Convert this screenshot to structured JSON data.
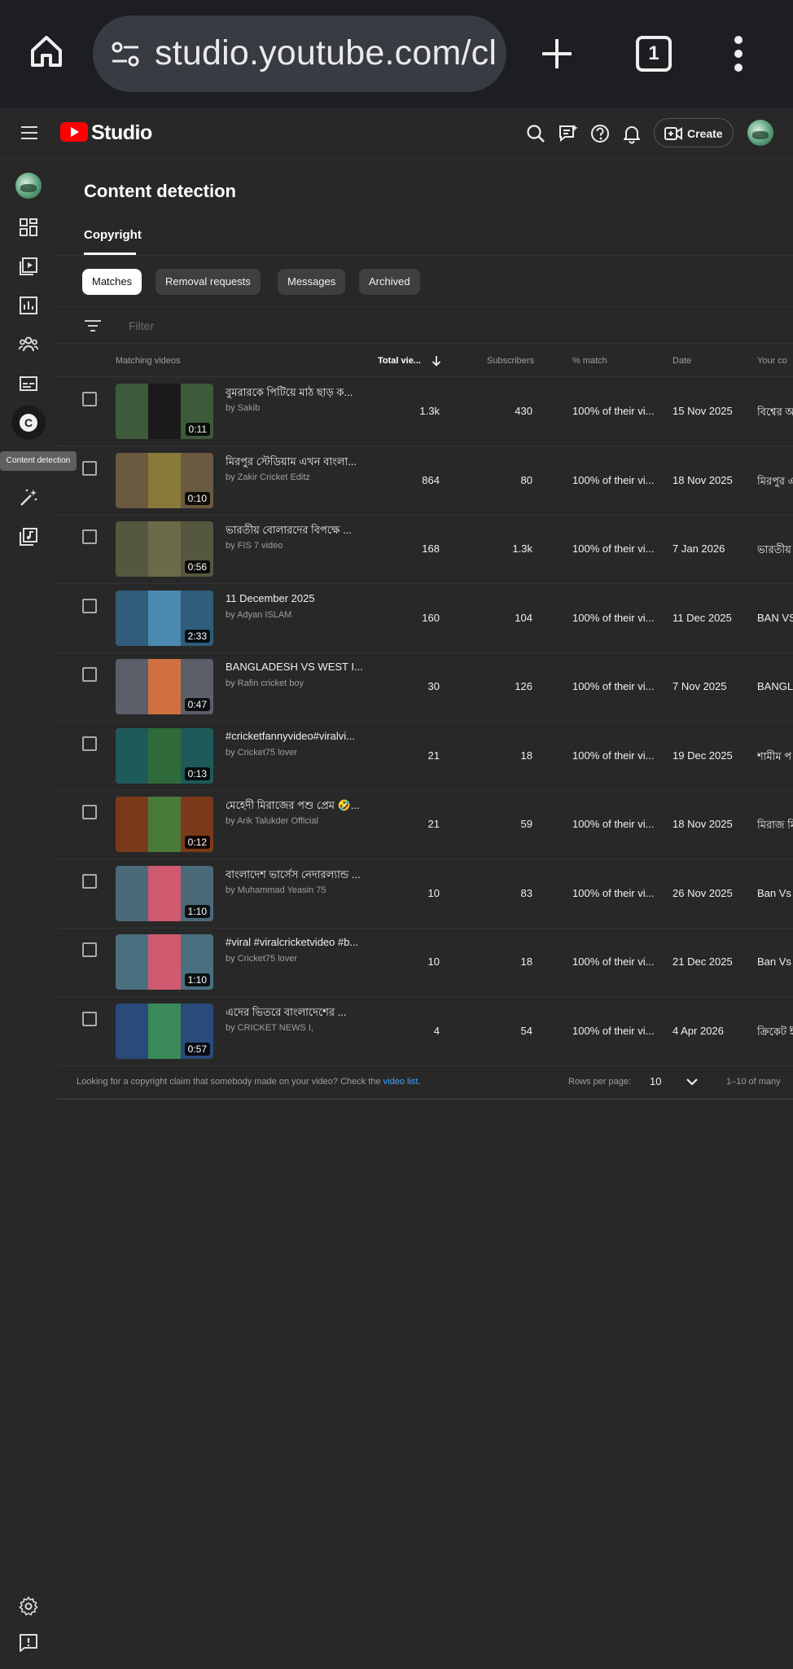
{
  "browser": {
    "url": "studio.youtube.com/cl",
    "tab_count": "1"
  },
  "appbar": {
    "logo_text": "Studio",
    "create_label": "Create"
  },
  "rail": {
    "tooltip": "Content detection",
    "active_glyph": "C"
  },
  "page": {
    "title": "Content detection",
    "tab": "Copyright",
    "chips": [
      "Matches",
      "Removal requests",
      "Messages",
      "Archived"
    ],
    "filter_placeholder": "Filter"
  },
  "table": {
    "columns": [
      "Matching videos",
      "Total vie...",
      "Subscribers",
      "% match",
      "Date",
      "Your co"
    ],
    "rows": [
      {
        "title": "বুমরারকে পিটিয়ে মাঠ ছাড় ক...",
        "by": "by Sakib",
        "duration": "0:11",
        "views": "1.3k",
        "subs": "430",
        "match": "100% of their vi...",
        "date": "15 Nov 2025",
        "yours": "বিশ্বের অ",
        "thumb_bg": "#3d5a3a",
        "thumb_inner": "#1a1a1a"
      },
      {
        "title": "মিরপুর স্টেডিয়াম এখন বাংলা...",
        "by": "by Zakir Cricket Editz",
        "duration": "0:10",
        "views": "864",
        "subs": "80",
        "match": "100% of their vi...",
        "date": "18 Nov 2025",
        "yours": "মিরপুর এ",
        "thumb_bg": "#6a5a40",
        "thumb_inner": "#8a7a3a"
      },
      {
        "title": "ভারতীয় বোলারদের বিপক্ষে ...",
        "by": "by FIS 7 video",
        "duration": "0:56",
        "views": "168",
        "subs": "1.3k",
        "match": "100% of their vi...",
        "date": "7 Jan 2026",
        "yours": "ভারতীয় ",
        "thumb_bg": "#55573f",
        "thumb_inner": "#6b6b4a"
      },
      {
        "title": "11 December 2025",
        "by": "by Adyan ISLAM",
        "duration": "2:33",
        "views": "160",
        "subs": "104",
        "match": "100% of their vi...",
        "date": "11 Dec 2025",
        "yours": "BAN VS",
        "thumb_bg": "#2f5d7a",
        "thumb_inner": "#4a8ab0"
      },
      {
        "title": "BANGLADESH VS WEST I...",
        "by": "by Rafin cricket boy",
        "duration": "0:47",
        "views": "30",
        "subs": "126",
        "match": "100% of their vi...",
        "date": "7 Nov 2025",
        "yours": "BANGLA",
        "thumb_bg": "#5a5f6a",
        "thumb_inner": "#d07040"
      },
      {
        "title": "#cricketfannyvideo#viralvi...",
        "by": "by Cricket75 lover",
        "duration": "0:13",
        "views": "21",
        "subs": "18",
        "match": "100% of their vi...",
        "date": "19 Dec 2025",
        "yours": "শামীম প",
        "thumb_bg": "#1f5a5a",
        "thumb_inner": "#2f6a3a"
      },
      {
        "title": "মেহেদী মিরাজের পশু প্রেম 🤣...",
        "by": "by Arik Talukder Official",
        "duration": "0:12",
        "views": "21",
        "subs": "59",
        "match": "100% of their vi...",
        "date": "18 Nov 2025",
        "yours": "মিরাজ মি",
        "thumb_bg": "#7a3a1a",
        "thumb_inner": "#4a7a3a"
      },
      {
        "title": "বাংলাদেশ ভার্সেস নেদারল্যান্ড ...",
        "by": "by Muhammad Yeasin 75",
        "duration": "1:10",
        "views": "10",
        "subs": "83",
        "match": "100% of their vi...",
        "date": "26 Nov 2025",
        "yours": "Ban Vs",
        "thumb_bg": "#4a6a7a",
        "thumb_inner": "#d05a70"
      },
      {
        "title": "#viral #viralcricketvideo #b...",
        "by": "by Cricket75 lover",
        "duration": "1:10",
        "views": "10",
        "subs": "18",
        "match": "100% of their vi...",
        "date": "21 Dec 2025",
        "yours": "Ban Vs",
        "thumb_bg": "#4a7080",
        "thumb_inner": "#d05a70"
      },
      {
        "title": "এদের ভিতরে বাংলাদেশের ...",
        "by": "by CRICKET NEWS I,",
        "duration": "0:57",
        "views": "4",
        "subs": "54",
        "match": "100% of their vi...",
        "date": "4 Apr 2026",
        "yours": "ক্রিকেট ই",
        "thumb_bg": "#2a4a7a",
        "thumb_inner": "#3a8a5a"
      }
    ]
  },
  "footer": {
    "msg_prefix": "Looking for a copyright claim that somebody made on your video? Check the ",
    "msg_link": "video list",
    "msg_suffix": ".",
    "rows_per_page_label": "Rows per page:",
    "rows_per_page_value": "10",
    "range": "1–10 of many"
  }
}
